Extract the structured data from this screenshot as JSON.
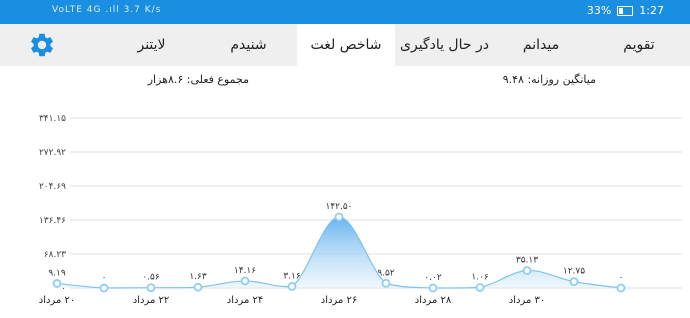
{
  "status_bar": {
    "left_text": "VoLTE 4G .ıll 3.7 K/s",
    "battery_percent": "33%",
    "time": "1:27"
  },
  "tabs": [
    {
      "label": "تقویم",
      "active": false
    },
    {
      "label": "میدانم",
      "active": false
    },
    {
      "label": "در حال یادگیری",
      "active": false
    },
    {
      "label": "شاخص لغت",
      "active": true
    },
    {
      "label": "شنیدم",
      "active": false
    },
    {
      "label": "لایتنر",
      "active": false
    }
  ],
  "settings_icon": "gear-icon",
  "stats": {
    "daily_average": "میانگین روزانه: ۹.۴۸",
    "actual_total": "مجموع فعلی: ۸.۶هزار"
  },
  "colors": {
    "status_bar": "#1a8ee0",
    "tab_bar": "#efefef",
    "accent": "#1a8ee0",
    "fill_light": "#e3f1fc"
  },
  "chart_data": {
    "type": "area",
    "y_ticks": [
      "۰",
      "۶۸.۲۳",
      "۱۳۶.۴۶",
      "۲۰۴.۶۹",
      "۲۷۲.۹۲",
      "۳۴۱.۱۵"
    ],
    "y_tick_values": [
      0,
      68.23,
      136.46,
      204.69,
      272.92,
      341.15
    ],
    "ylim": [
      0,
      341.15
    ],
    "x_labels": [
      "۲۰ مرداد",
      "۲۲ مرداد",
      "۲۴ مرداد",
      "۲۶ مرداد",
      "۲۸ مرداد",
      "۳۰ مرداد"
    ],
    "x_label_slots": [
      0,
      2,
      4,
      6,
      8,
      10
    ],
    "values": [
      9.19,
      0,
      0.56,
      1.63,
      14.16,
      3.16,
      142.5,
      9.52,
      0.02,
      1.06,
      35.13,
      12.75,
      0
    ],
    "value_labels": [
      "۹.۱۹",
      "۰",
      "۰.۵۶",
      "۱.۶۳",
      "۱۴.۱۶",
      "۳.۱۶",
      "۱۴۲.۵۰",
      "۹.۵۲",
      "۰.۰۲",
      "۱.۰۶",
      "۳۵.۱۳",
      "۱۲.۷۵",
      "۰"
    ],
    "grid": true
  }
}
